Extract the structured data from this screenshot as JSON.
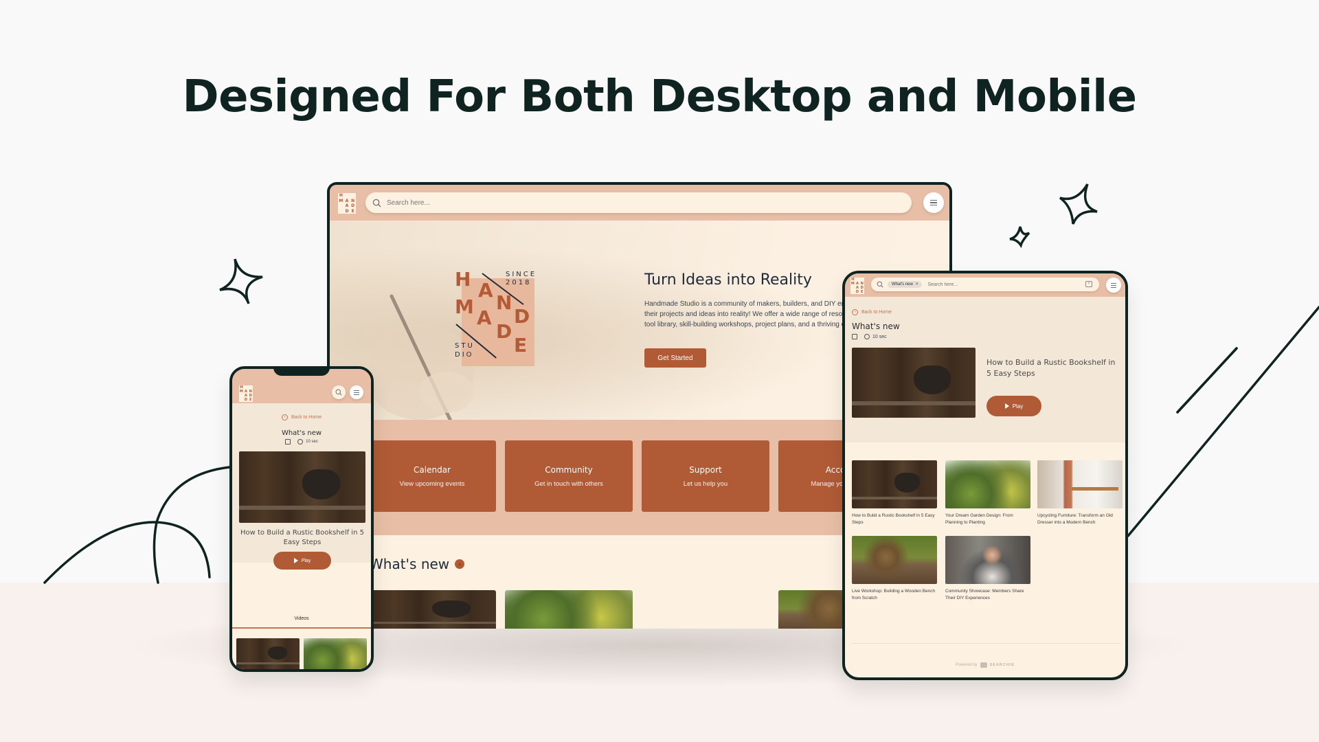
{
  "headline": "Designed For Both Desktop and Mobile",
  "colors": {
    "brand": "#b05b36",
    "brand_light": "#e8bfa6",
    "background": "#fdf1e2",
    "ink": "#0f2420"
  },
  "logo": {
    "letters": [
      "H",
      "",
      "",
      "M",
      "A",
      "N",
      "",
      "A",
      "D",
      "",
      "D",
      "E"
    ],
    "mark_letters": [
      "H",
      "A",
      "M",
      "N",
      "A",
      "D",
      "D",
      "E"
    ],
    "since": "SINCE",
    "year": "2018",
    "studio_1": "STU",
    "studio_2": "DIO"
  },
  "desktop": {
    "search_placeholder": "Search here...",
    "menu_icon": "hamburger-icon",
    "hero": {
      "title": "Turn Ideas into Reality",
      "body": "Handmade Studio is a community of makers, builders, and DIY enthusiasts who come together to turn their projects and ideas into reality! We offer a wide range of resources and tools, including access to a tool library, skill-building workshops, project plans, and a thriving online community.",
      "cta": "Get Started"
    },
    "cards": [
      {
        "title": "Calendar",
        "subtitle": "View upcoming events"
      },
      {
        "title": "Community",
        "subtitle": "Get in touch with others"
      },
      {
        "title": "Support",
        "subtitle": "Let us help you"
      },
      {
        "title": "Account",
        "subtitle": "Manage your account"
      }
    ],
    "section_title": "What's new",
    "section_arrow": "›"
  },
  "tablet": {
    "chip_label": "What's new",
    "chip_close": "×",
    "search_placeholder": "Search here...",
    "clear_icon": "×",
    "back_label": "Back to Home",
    "page_title": "What's new",
    "duration": "10 sec",
    "featured": {
      "title": "How to Build a Rustic Bookshelf in 5 Easy Steps",
      "play_label": "Play"
    },
    "videos": [
      {
        "title": "How to Build a Rustic Bookshelf in 5 Easy Steps",
        "image": "shelf"
      },
      {
        "title": "Your Dream Garden Design: From Planning to Planting",
        "image": "garden"
      },
      {
        "title": "Upcycling Furniture: Transform an Old Dresser into a Modern Bench",
        "image": "room"
      },
      {
        "title": "Live Workshop: Building a Wooden Bench from Scratch",
        "image": "bench"
      },
      {
        "title": "Community Showcase: Members Share Their DIY Experiences",
        "image": "person"
      }
    ],
    "powered_by": "Powered by",
    "powered_brand": "SEARCHIE"
  },
  "mobile": {
    "back_label": "Back to Home",
    "page_title": "What's new",
    "duration": "10 sec",
    "featured": {
      "title": "How to Build a Rustic Bookshelf in 5 Easy Steps",
      "play_label": "Play"
    },
    "tab_label": "Videos"
  }
}
